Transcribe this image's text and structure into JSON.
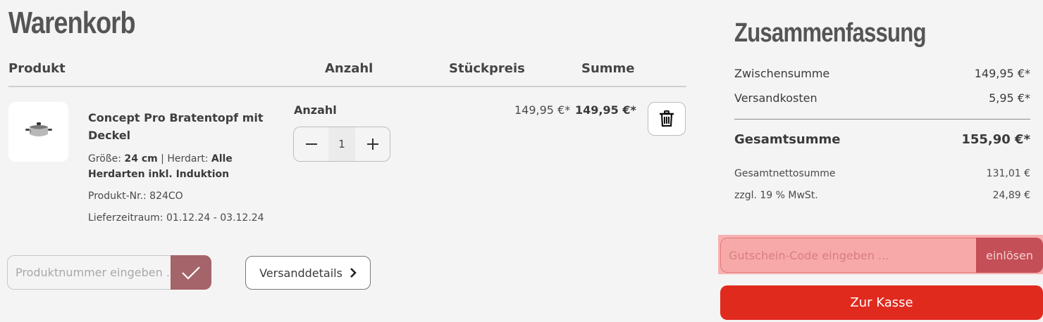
{
  "page_title": "Warenkorb",
  "table_headers": {
    "product": "Produkt",
    "quantity": "Anzahl",
    "unit_price": "Stückpreis",
    "total": "Summe"
  },
  "item": {
    "name": "Concept Pro Bratentopf mit Deckel",
    "size_label": "Größe: ",
    "size_value": "24 cm",
    "separator": " | Herdart: ",
    "herdart_value": "Alle Herdarten inkl. Induktion",
    "product_nr": "Produkt-Nr.: 824CO",
    "delivery": "Lieferzeitraum: 01.12.24 - 03.12.24",
    "quantity_label": "Anzahl",
    "quantity": "1",
    "unit_price": "149,95 €*",
    "total_price": "149,95 €*",
    "image_icon": "pot-icon",
    "remove_icon": "trash-icon"
  },
  "add_product": {
    "placeholder": "Produktnummer eingeben ...",
    "submit_icon": "check-icon"
  },
  "shipping_details": {
    "label": "Versanddetails",
    "icon": "chevron-right-icon"
  },
  "summary": {
    "title": "Zusammenfassung",
    "subtotal_label": "Zwischensumme",
    "subtotal_value": "149,95 €*",
    "shipping_label": "Versandkosten",
    "shipping_value": "5,95 €*",
    "grand_total_label": "Gesamtsumme",
    "grand_total_value": "155,90 €*",
    "net_label": "Gesamtnettosumme",
    "net_value": "131,01 €",
    "vat_label": "zzgl. 19 % MwSt.",
    "vat_value": "24,89 €"
  },
  "voucher": {
    "placeholder": "Gutschein-Code eingeben ...",
    "button_label": "einlösen"
  },
  "checkout": {
    "label": "Zur Kasse"
  },
  "colors": {
    "accent_red": "#e02a1e",
    "muted_red": "#a5636a",
    "background": "#f4f4f4"
  }
}
